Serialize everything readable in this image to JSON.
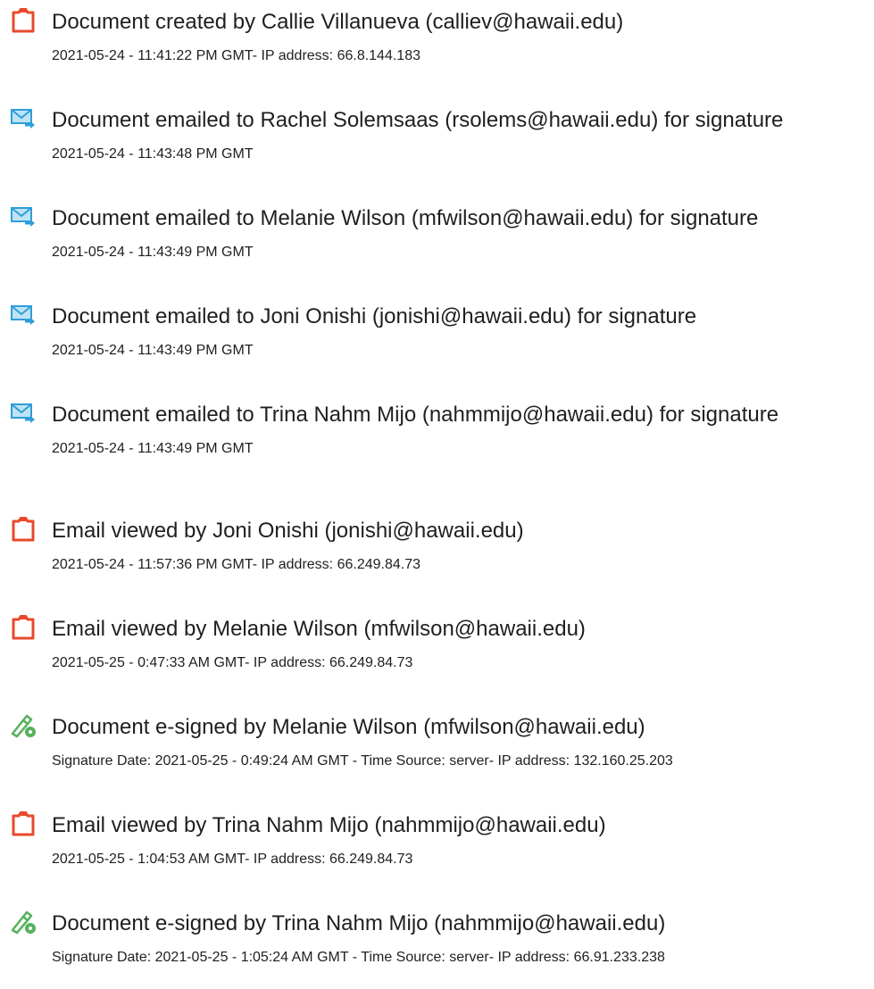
{
  "events": [
    {
      "icon": "document-created-icon",
      "title": "Document created by Callie Villanueva (calliev@hawaii.edu)",
      "detail": "2021-05-24 - 11:41:22 PM GMT- IP address: 66.8.144.183"
    },
    {
      "icon": "email-sent-icon",
      "title": "Document emailed to Rachel Solemsaas (rsolems@hawaii.edu) for signature",
      "detail": "2021-05-24 - 11:43:48 PM GMT"
    },
    {
      "icon": "email-sent-icon",
      "title": "Document emailed to Melanie Wilson (mfwilson@hawaii.edu) for signature",
      "detail": "2021-05-24 - 11:43:49 PM GMT"
    },
    {
      "icon": "email-sent-icon",
      "title": "Document emailed to Joni Onishi (jonishi@hawaii.edu) for signature",
      "detail": "2021-05-24 - 11:43:49 PM GMT"
    },
    {
      "icon": "email-sent-icon",
      "title": "Document emailed to Trina Nahm Mijo (nahmmijo@hawaii.edu) for signature",
      "detail": "2021-05-24 - 11:43:49 PM GMT"
    },
    {
      "icon": "document-viewed-icon",
      "title": "Email viewed by Joni Onishi (jonishi@hawaii.edu)",
      "detail": "2021-05-24 - 11:57:36 PM GMT- IP address: 66.249.84.73"
    },
    {
      "icon": "document-viewed-icon",
      "title": "Email viewed by Melanie Wilson (mfwilson@hawaii.edu)",
      "detail": "2021-05-25 - 0:47:33 AM GMT- IP address: 66.249.84.73"
    },
    {
      "icon": "esign-pen-icon",
      "title": "Document e-signed by Melanie Wilson (mfwilson@hawaii.edu)",
      "detail": "Signature Date: 2021-05-25 - 0:49:24 AM GMT - Time Source: server- IP address: 132.160.25.203"
    },
    {
      "icon": "document-viewed-icon",
      "title": "Email viewed by Trina Nahm Mijo (nahmmijo@hawaii.edu)",
      "detail": "2021-05-25 - 1:04:53 AM GMT- IP address: 66.249.84.73"
    },
    {
      "icon": "esign-pen-icon",
      "title": "Document e-signed by Trina Nahm Mijo (nahmmijo@hawaii.edu)",
      "detail": "Signature Date: 2021-05-25 - 1:05:24 AM GMT - Time Source: server- IP address: 66.91.233.238"
    }
  ],
  "colors": {
    "doc_icon": "#e8492b",
    "email_icon": "#2e9ed8",
    "pen_icon": "#56b25c",
    "text": "#1f1f1f"
  }
}
